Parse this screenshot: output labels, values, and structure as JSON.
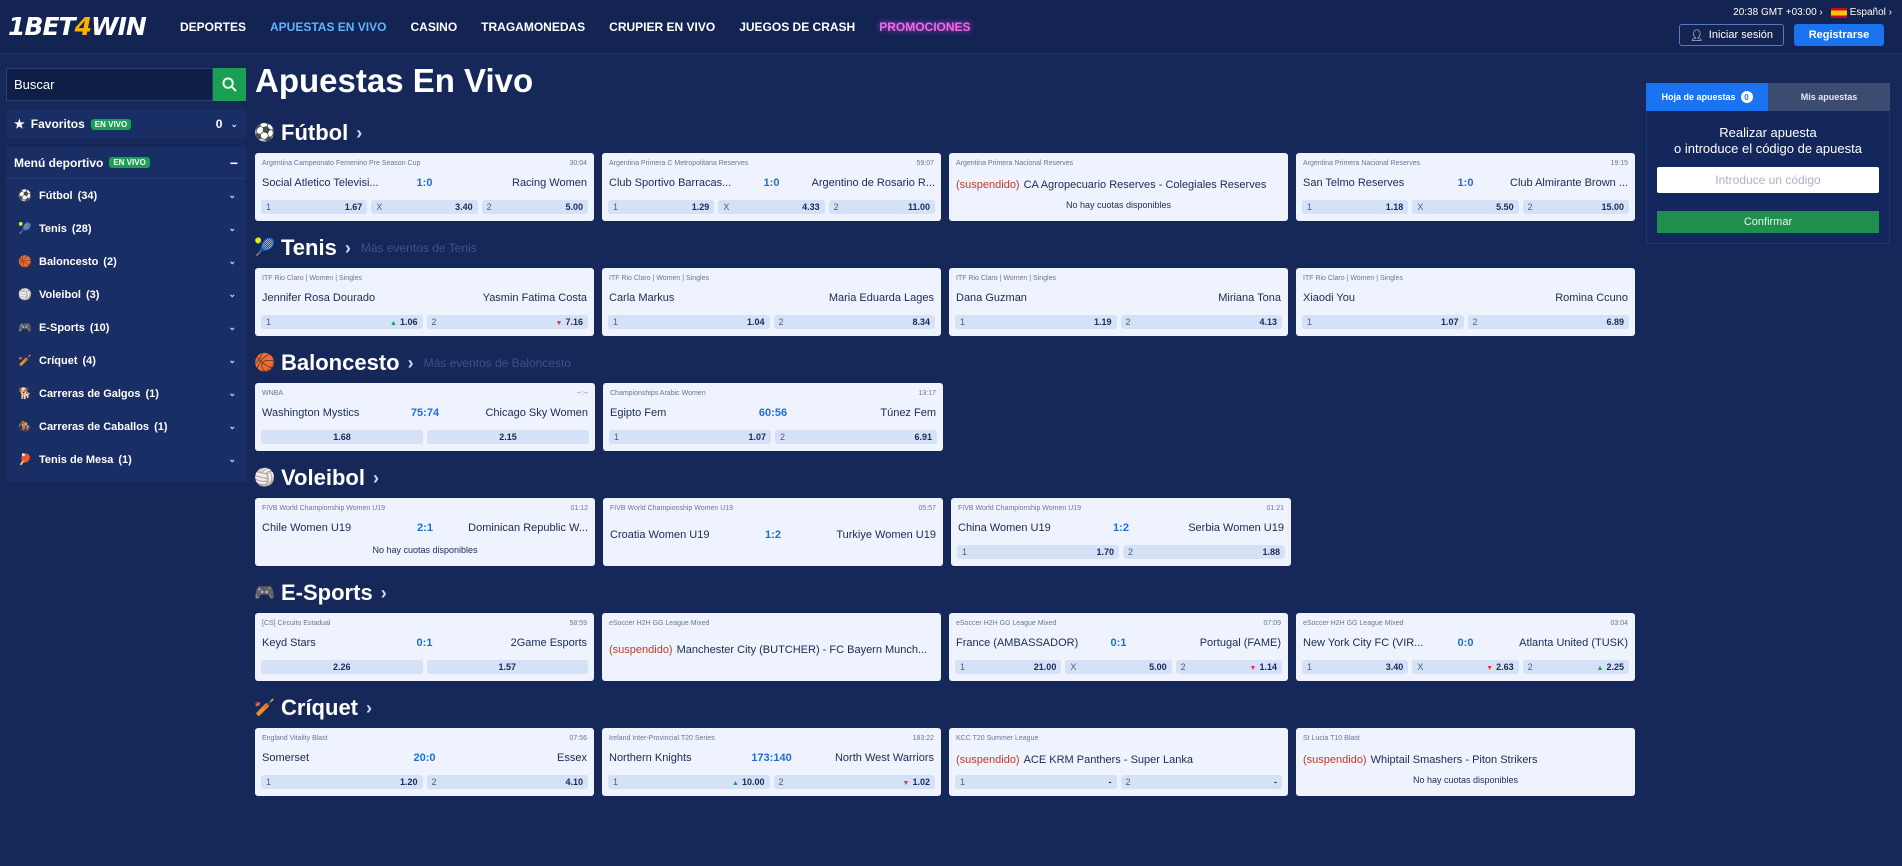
{
  "header": {
    "logo_a": "1BET",
    "logo_b": "4",
    "logo_c": "WIN",
    "nav": [
      "DEPORTES",
      "APUESTAS EN VIVO",
      "CASINO",
      "TRAGAMONEDAS",
      "CRUPIER EN VIVO",
      "JUEGOS DE CRASH",
      "PROMOCIONES"
    ],
    "time": "20:38",
    "timezone": "GMT +03:00",
    "language": "Español",
    "login_label": "Iniciar sesión",
    "register_label": "Registrarse"
  },
  "sidebar": {
    "search_placeholder": "Buscar",
    "favorites_label": "Favoritos",
    "live_badge": "EN VIVO",
    "favorites_count": "0",
    "menu_label": "Menú deportivo",
    "items": [
      {
        "icon": "⚽",
        "label": "Fútbol",
        "count": "(34)"
      },
      {
        "icon": "🎾",
        "label": "Tenis",
        "count": "(28)"
      },
      {
        "icon": "🏀",
        "label": "Baloncesto",
        "count": "(2)"
      },
      {
        "icon": "🏐",
        "label": "Voleibol",
        "count": "(3)"
      },
      {
        "icon": "🎮",
        "label": "E-Sports",
        "count": "(10)"
      },
      {
        "icon": "🏏",
        "label": "Críquet",
        "count": "(4)"
      },
      {
        "icon": "🐕",
        "label": "Carreras de Galgos",
        "count": "(1)"
      },
      {
        "icon": "🏇",
        "label": "Carreras de Caballos",
        "count": "(1)"
      },
      {
        "icon": "🏓",
        "label": "Tenis de Mesa",
        "count": "(1)"
      }
    ]
  },
  "main": {
    "title": "Apuestas En Vivo",
    "sections": [
      {
        "icon": "⚽",
        "name": "Fútbol",
        "more": "",
        "cards": [
          {
            "league": "Argentina Campeonato Femenino Pre Season Cup",
            "time": "30:04",
            "team1": "Social Atletico Televisi...",
            "score": "1:0",
            "team2": "Racing Women",
            "odds": [
              {
                "l": "1",
                "v": "1.67"
              },
              {
                "l": "X",
                "v": "3.40"
              },
              {
                "l": "2",
                "v": "5.00"
              }
            ]
          },
          {
            "league": "Argentina Primera C Metropolitana Reserves",
            "time": "59:07",
            "team1": "Club Sportivo Barracas...",
            "score": "1:0",
            "team2": "Argentino de Rosario R...",
            "odds": [
              {
                "l": "1",
                "v": "1.29"
              },
              {
                "l": "X",
                "v": "4.33"
              },
              {
                "l": "2",
                "v": "11.00"
              }
            ]
          },
          {
            "league": "Argentina Primera Nacional Reserves",
            "time": "",
            "suspended": "(suspendido)",
            "match": "CA Agropecuario Reserves - Colegiales Reserves",
            "no_odds": "No hay cuotas disponibles"
          },
          {
            "league": "Argentina Primera Nacional Reserves",
            "time": "19:15",
            "team1": "San Telmo Reserves",
            "score": "1:0",
            "team2": "Club Almirante Brown ...",
            "odds": [
              {
                "l": "1",
                "v": "1.18"
              },
              {
                "l": "X",
                "v": "5.50"
              },
              {
                "l": "2",
                "v": "15.00"
              }
            ]
          }
        ]
      },
      {
        "icon": "🎾",
        "name": "Tenis",
        "more": "Más eventos de Tenis",
        "cards": [
          {
            "league": "ITF Rio Claro | Women | Singles",
            "time": "",
            "team1": "Jennifer Rosa Dourado",
            "score": "",
            "team2": "Yasmin Fatima Costa",
            "odds": [
              {
                "l": "1",
                "v": "1.06",
                "t": "up"
              },
              {
                "l": "2",
                "v": "7.16",
                "t": "dn"
              }
            ]
          },
          {
            "league": "ITF Rio Claro | Women | Singles",
            "time": "",
            "team1": "Carla Markus",
            "score": "",
            "team2": "Maria Eduarda Lages",
            "odds": [
              {
                "l": "1",
                "v": "1.04"
              },
              {
                "l": "2",
                "v": "8.34"
              }
            ]
          },
          {
            "league": "ITF Rio Claro | Women | Singles",
            "time": "",
            "team1": "Dana Guzman",
            "score": "",
            "team2": "Miriana Tona",
            "odds": [
              {
                "l": "1",
                "v": "1.19"
              },
              {
                "l": "2",
                "v": "4.13"
              }
            ]
          },
          {
            "league": "ITF Rio Claro | Women | Singles",
            "time": "",
            "team1": "Xiaodi You",
            "score": "",
            "team2": "Romina Ccuno",
            "odds": [
              {
                "l": "1",
                "v": "1.07"
              },
              {
                "l": "2",
                "v": "6.89"
              }
            ]
          }
        ]
      },
      {
        "icon": "🏀",
        "name": "Baloncesto",
        "more": "Más eventos de Baloncesto",
        "cards": [
          {
            "league": "WNBA",
            "time": "--:--",
            "team1": "Washington Mystics",
            "score": "75:74",
            "team2": "Chicago Sky Women",
            "odds": [
              {
                "l": "",
                "v": "1.68"
              },
              {
                "l": "",
                "v": "2.15"
              }
            ]
          },
          {
            "league": "Championships Arabic Women",
            "time": "13:17",
            "team1": "Egipto Fem",
            "score": "60:56",
            "team2": "Túnez Fem",
            "odds": [
              {
                "l": "1",
                "v": "1.07"
              },
              {
                "l": "2",
                "v": "6.91"
              }
            ]
          }
        ]
      },
      {
        "icon": "🏐",
        "name": "Voleibol",
        "more": "",
        "cards": [
          {
            "league": "FIVB World Championship Women U19",
            "time": "01:12",
            "team1": "Chile Women U19",
            "score": "2:1",
            "team2": "Dominican Republic W...",
            "no_odds": "No hay cuotas disponibles"
          },
          {
            "league": "FIVB World Championship Women U19",
            "time": "05:57",
            "team1": "Croatia Women U19",
            "score": "1:2",
            "team2": "Turkiye Women U19",
            "mid": true
          },
          {
            "league": "FIVB World Championship Women U19",
            "time": "01:21",
            "team1": "China Women U19",
            "score": "1:2",
            "team2": "Serbia Women U19",
            "odds": [
              {
                "l": "1",
                "v": "1.70"
              },
              {
                "l": "2",
                "v": "1.88"
              }
            ]
          }
        ]
      },
      {
        "icon": "🎮",
        "name": "E-Sports",
        "more": "",
        "cards": [
          {
            "league": "[CS] Circuito Estadual",
            "time": "58:59",
            "team1": "Keyd Stars",
            "score": "0:1",
            "team2": "2Game Esports",
            "odds": [
              {
                "l": "",
                "v": "2.26"
              },
              {
                "l": "",
                "v": "1.57"
              }
            ]
          },
          {
            "league": "eSoccer H2H GG League Mixed",
            "time": "",
            "suspended": "(suspendido)",
            "match": "Manchester City (BUTCHER) - FC Bayern Munch...",
            "mid": true
          },
          {
            "league": "eSoccer H2H GG League Mixed",
            "time": "07:09",
            "team1": "France (AMBASSADOR)",
            "score": "0:1",
            "team2": "Portugal (FAME)",
            "odds": [
              {
                "l": "1",
                "v": "21.00"
              },
              {
                "l": "X",
                "v": "5.00"
              },
              {
                "l": "2",
                "v": "1.14",
                "t": "dn"
              }
            ]
          },
          {
            "league": "eSoccer H2H GG League Mixed",
            "time": "03:04",
            "team1": "New York City FC (VIR...",
            "score": "0:0",
            "team2": "Atlanta United (TUSK)",
            "odds": [
              {
                "l": "1",
                "v": "3.40"
              },
              {
                "l": "X",
                "v": "2.63",
                "t": "dn"
              },
              {
                "l": "2",
                "v": "2.25",
                "t": "up"
              }
            ]
          }
        ]
      },
      {
        "icon": "🏏",
        "name": "Críquet",
        "more": "",
        "cards": [
          {
            "league": "England Vitality Blast",
            "time": "07:56",
            "team1": "Somerset",
            "score": "20:0",
            "team2": "Essex",
            "odds": [
              {
                "l": "1",
                "v": "1.20"
              },
              {
                "l": "2",
                "v": "4.10"
              }
            ]
          },
          {
            "league": "Ireland Inter-Provincial T20 Series",
            "time": "183:22",
            "team1": "Northern Knights",
            "score": "173:140",
            "team2": "North West Warriors",
            "odds": [
              {
                "l": "1",
                "v": "10.00",
                "t": "up"
              },
              {
                "l": "2",
                "v": "1.02",
                "t": "dn"
              }
            ]
          },
          {
            "league": "KCC T20 Summer League",
            "time": "",
            "suspended": "(suspendido)",
            "match": "ACE KRM Panthers - Super Lanka",
            "odds": [
              {
                "l": "1",
                "v": "-"
              },
              {
                "l": "2",
                "v": "-"
              }
            ]
          },
          {
            "league": "St Lucia T10 Blast",
            "time": "",
            "suspended": "(suspendido)",
            "match": "Whiptail Smashers - Piton Strikers",
            "no_odds": "No hay cuotas disponibles"
          }
        ]
      }
    ]
  },
  "betslip": {
    "tab_active": "Hoja de apuestas",
    "tab_count": "0",
    "tab_inactive": "Mis apuestas",
    "line1": "Realizar apuesta",
    "line2": "o introduce el código de apuesta",
    "code_placeholder": "Introduce un código",
    "confirm_label": "Confirmar"
  },
  "colors": {
    "accent": "#1a73f0",
    "green": "#1aa053",
    "bg": "#16285a"
  }
}
